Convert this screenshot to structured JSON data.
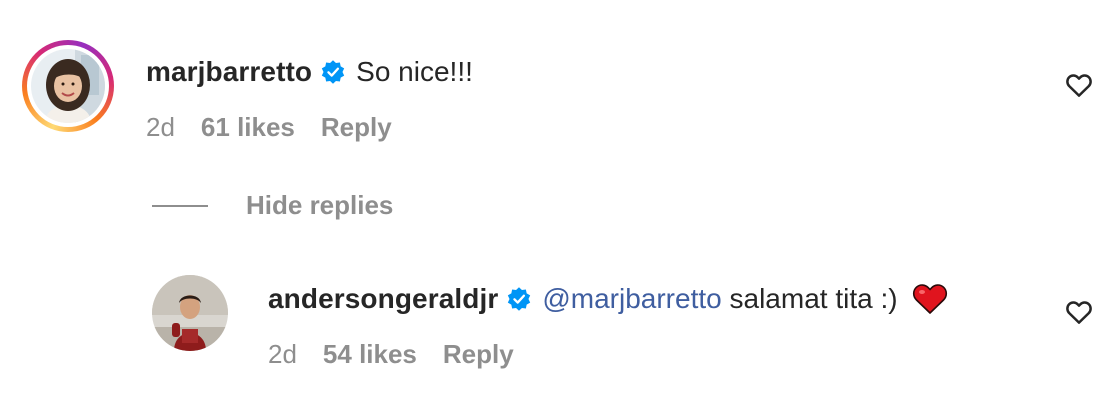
{
  "comments": [
    {
      "username": "marjbarretto",
      "text": "So nice!!!",
      "time": "2d",
      "likes": "61 likes",
      "reply": "Reply",
      "avatar": "woman-portrait-avatar",
      "avatar_story_ring": true
    },
    {
      "username": "andersongeraldjr",
      "mention": "@marjbarretto",
      "text": " salamat tita :)",
      "emoji": "red-heart",
      "time": "2d",
      "likes": "54 likes",
      "reply": "Reply",
      "avatar": "man-portrait-avatar"
    }
  ],
  "replies_toggle": "Hide replies",
  "colors": {
    "text": "#262626",
    "muted": "#8e8e8e",
    "verified": "#0095f6",
    "mention": "#3f5ea0"
  },
  "icons": {
    "verified": "verified-badge-icon",
    "like": "heart-outline-icon"
  }
}
